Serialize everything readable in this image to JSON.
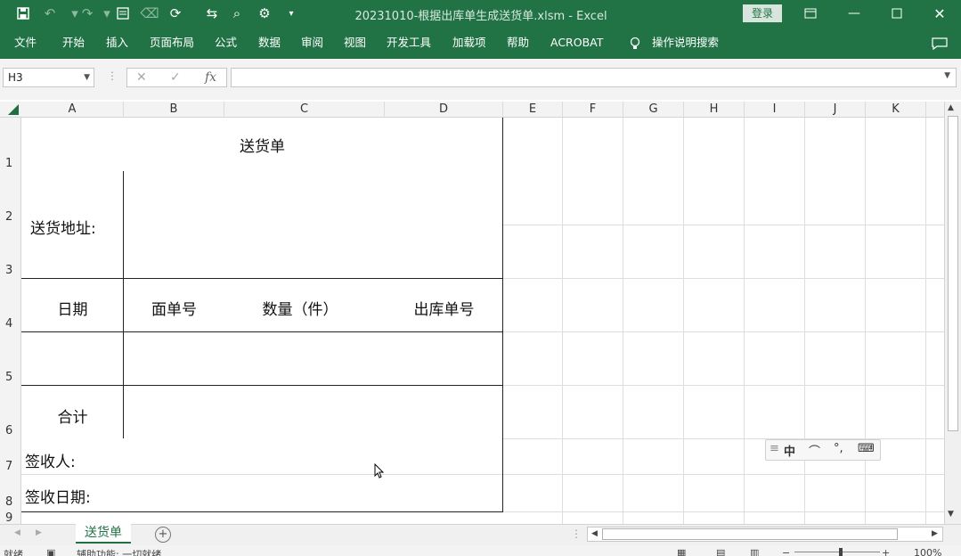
{
  "window": {
    "title": "20231010-根据出库单生成送货单.xlsm - Excel",
    "login_label": "登录",
    "qat_more": "▾"
  },
  "ribbon": {
    "tabs": [
      "文件",
      "开始",
      "插入",
      "页面布局",
      "公式",
      "数据",
      "审阅",
      "视图",
      "开发工具",
      "加载项",
      "帮助",
      "ACROBAT"
    ],
    "search_label": "操作说明搜索"
  },
  "formula_bar": {
    "name_box": "H3",
    "fx_symbol": "fx",
    "cancel_symbol": "✕",
    "enter_symbol": "✓",
    "formula": ""
  },
  "columns": [
    "A",
    "B",
    "C",
    "D",
    "E",
    "F",
    "G",
    "H",
    "I",
    "J",
    "K"
  ],
  "rows": [
    "1",
    "2",
    "3",
    "4",
    "5",
    "6",
    "7",
    "8",
    "9"
  ],
  "sheet": {
    "title": "送货单",
    "address_label": "送货地址:",
    "header_date": "日期",
    "header_order": "面单号",
    "header_qty": "数量（件）",
    "header_outbound": "出库单号",
    "total_label": "合计",
    "signer_label": "签收人:",
    "sign_date_label": "签收日期:"
  },
  "ime_bar": {
    "items": [
      "中",
      "⌒",
      "°,",
      "⌨"
    ]
  },
  "sheet_tabs": {
    "active": "送货单",
    "add_symbol": "+"
  },
  "status": {
    "ready": "就绪",
    "accessibility": "辅助功能: 一切就绪",
    "zoom": "100%"
  },
  "colors": {
    "accent": "#217346"
  }
}
